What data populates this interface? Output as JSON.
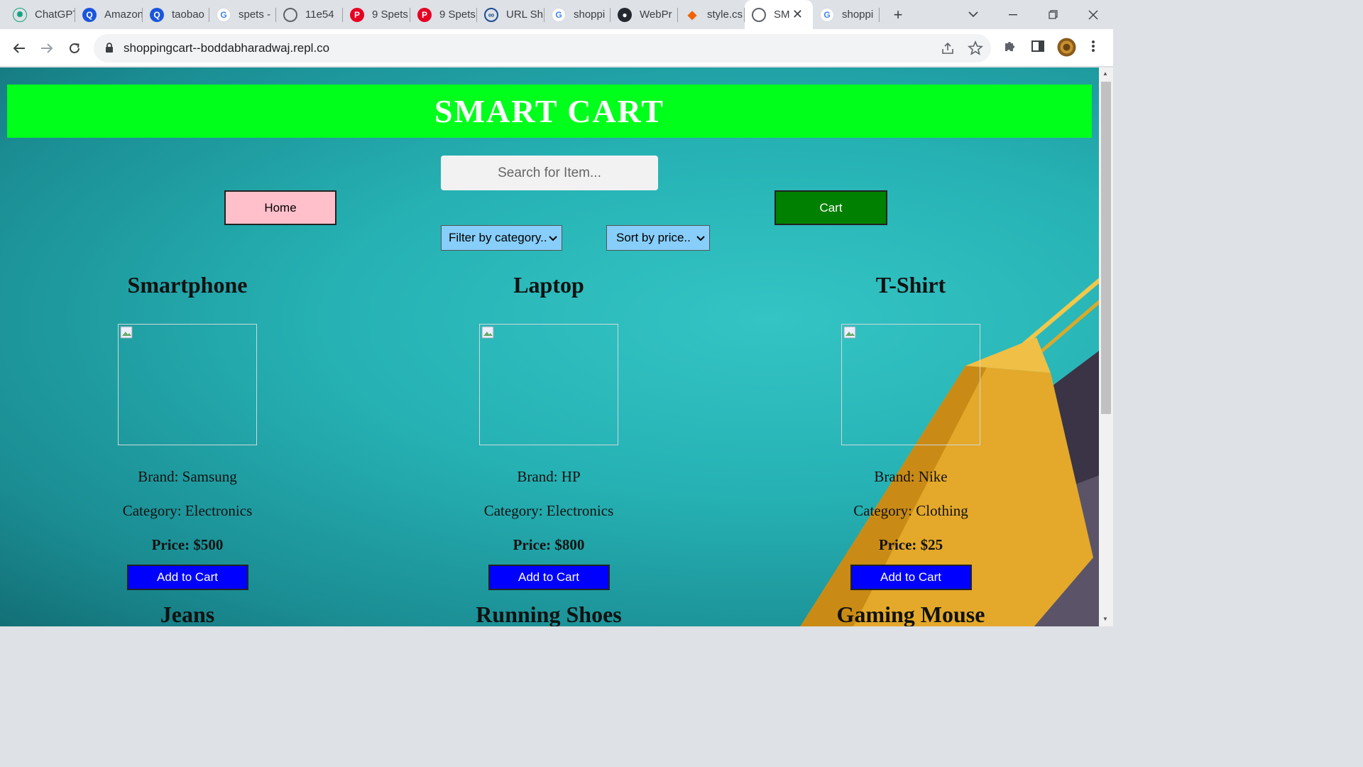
{
  "browser": {
    "tabs": [
      {
        "title": "ChatGPT",
        "icon": "chatgpt-icon",
        "color": "#10a37f",
        "glyph": "✺"
      },
      {
        "title": "Amazon",
        "icon": "search-q-icon",
        "color": "#1a56db",
        "glyph": "Q"
      },
      {
        "title": "taobao",
        "icon": "search-q-icon",
        "color": "#1a56db",
        "glyph": "Q"
      },
      {
        "title": "spets -",
        "icon": "google-icon",
        "color": "#4285f4",
        "glyph": "G"
      },
      {
        "title": "11e54",
        "icon": "globe-icon",
        "color": "#5f6368",
        "glyph": "◍"
      },
      {
        "title": "9 Spets",
        "icon": "pinterest-icon",
        "color": "#e60023",
        "glyph": "P"
      },
      {
        "title": "9 Spets",
        "icon": "pinterest-icon",
        "color": "#e60023",
        "glyph": "P"
      },
      {
        "title": "URL Sh",
        "icon": "link-icon",
        "color": "#3c4043",
        "glyph": "⊘"
      },
      {
        "title": "shoppi",
        "icon": "google-icon",
        "color": "#4285f4",
        "glyph": "G"
      },
      {
        "title": "WebPr",
        "icon": "github-icon",
        "color": "#24292f",
        "glyph": "●"
      },
      {
        "title": "style.cs",
        "icon": "replit-icon",
        "color": "#f26207",
        "glyph": "◆"
      },
      {
        "title": "SM",
        "icon": "globe-icon",
        "color": "#5f6368",
        "glyph": "◍",
        "active": true
      },
      {
        "title": "shoppi",
        "icon": "google-icon",
        "color": "#4285f4",
        "glyph": "G"
      }
    ],
    "url": "shoppingcart--boddabharadwaj.repl.co"
  },
  "page": {
    "title": "SMART CART",
    "search_placeholder": "Search for Item...",
    "home_label": "Home",
    "cart_label": "Cart",
    "filter_label": "Filter by category..",
    "sort_label": "Sort by price..",
    "colors": {
      "header": "#00ff1b",
      "home": "#ffc0cb",
      "cart": "#008000",
      "select": "#87cefa",
      "add": "#0000ff"
    }
  },
  "products": [
    {
      "name": "Smartphone",
      "brand": "Brand: Samsung",
      "category": "Category: Electronics",
      "price": "Price: $500",
      "button": "Add to Cart"
    },
    {
      "name": "Laptop",
      "brand": "Brand: HP",
      "category": "Category: Electronics",
      "price": "Price: $800",
      "button": "Add to Cart"
    },
    {
      "name": "T-Shirt",
      "brand": "Brand: Nike",
      "category": "Category: Clothing",
      "price": "Price: $25",
      "button": "Add to Cart"
    }
  ],
  "next_products": [
    "Jeans",
    "Running Shoes",
    "Gaming Mouse"
  ]
}
